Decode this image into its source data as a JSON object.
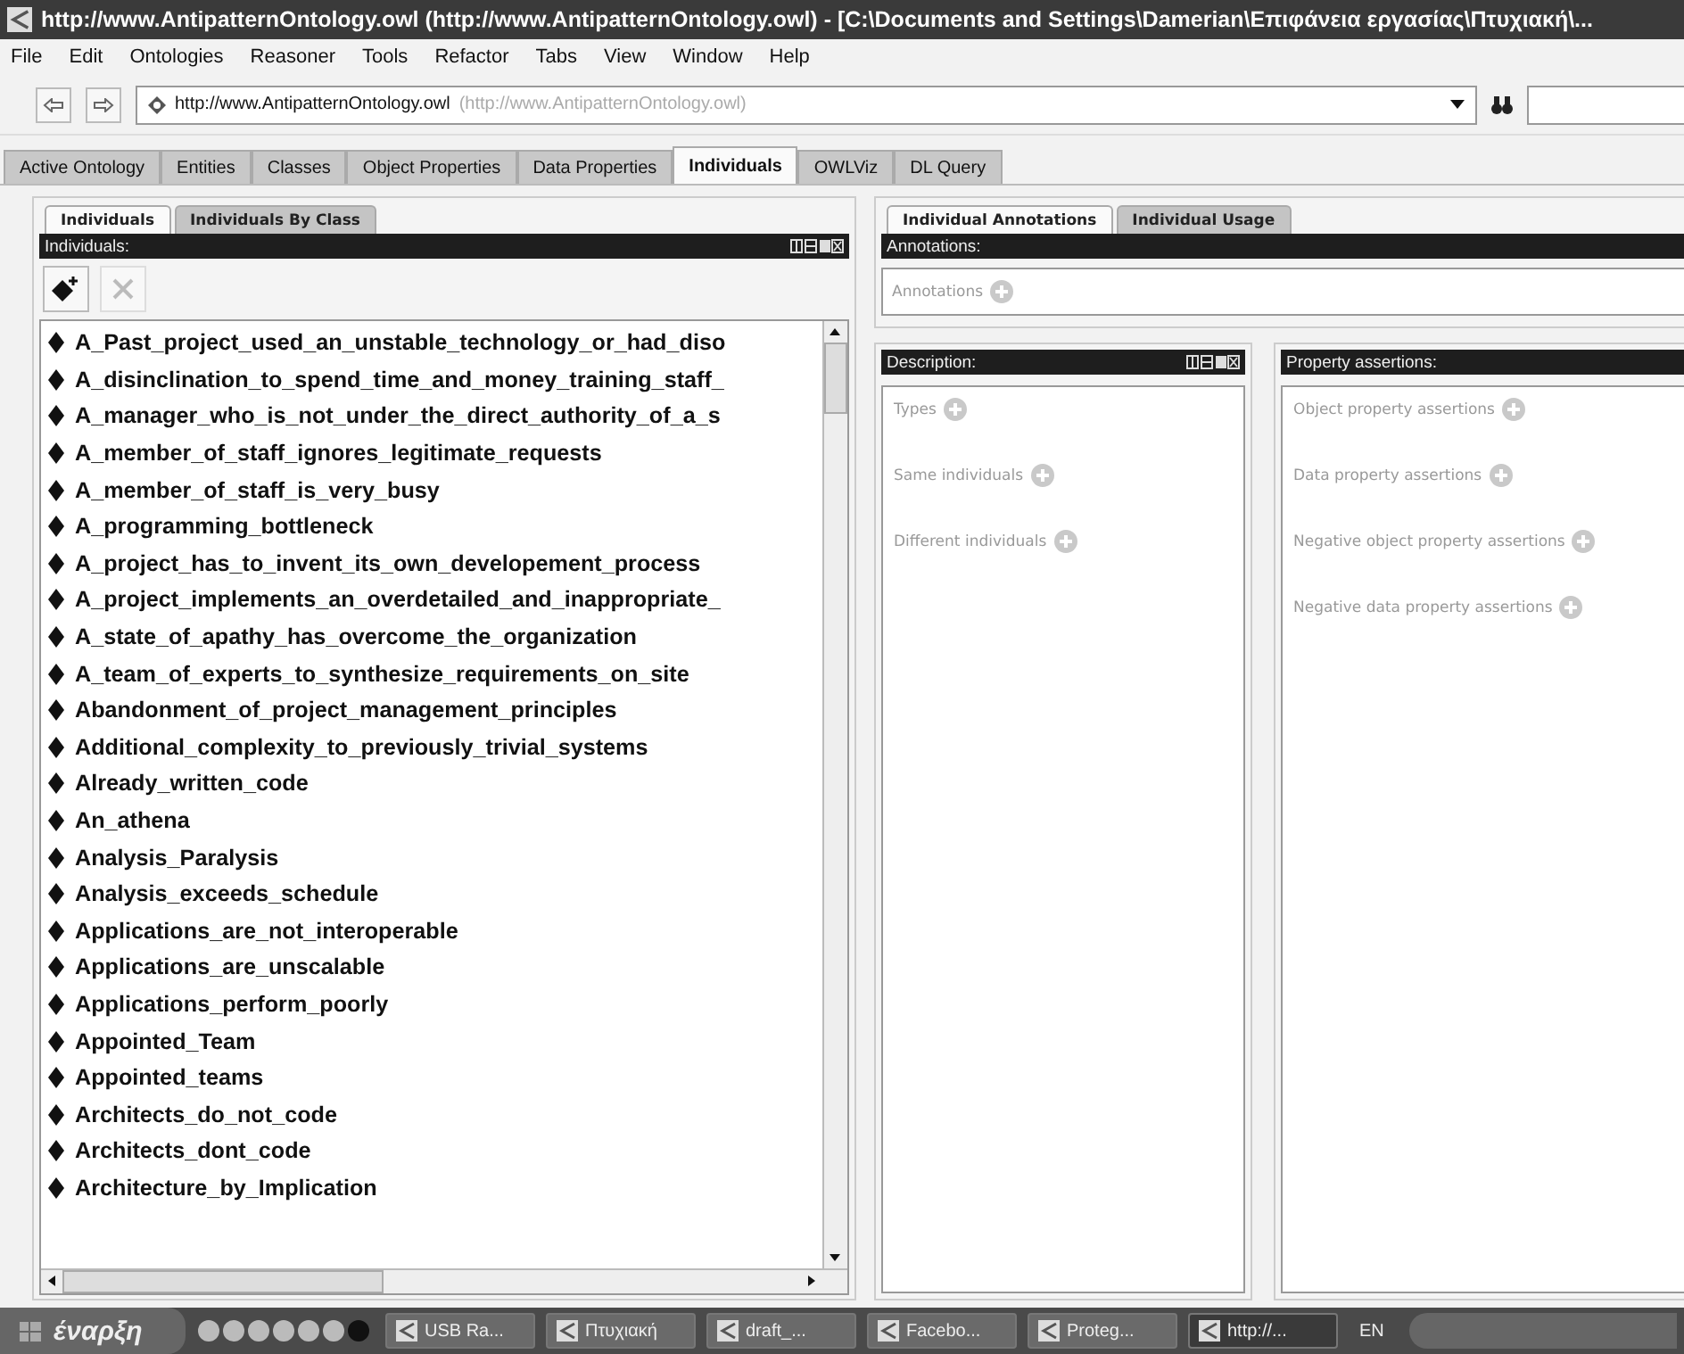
{
  "window": {
    "title": "http://www.AntipatternOntology.owl (http://www.AntipatternOntology.owl) - [C:\\Documents and Settings\\Damerian\\Επιφάνεια εργασίας\\Πτυχιακή\\..."
  },
  "menu": [
    "File",
    "Edit",
    "Ontologies",
    "Reasoner",
    "Tools",
    "Refactor",
    "Tabs",
    "View",
    "Window",
    "Help"
  ],
  "address": {
    "url": "http://www.AntipatternOntology.owl",
    "url_note": "(http://www.AntipatternOntology.owl)"
  },
  "tabs": [
    {
      "label": "Active Ontology",
      "selected": false
    },
    {
      "label": "Entities",
      "selected": false
    },
    {
      "label": "Classes",
      "selected": false
    },
    {
      "label": "Object Properties",
      "selected": false
    },
    {
      "label": "Data Properties",
      "selected": false
    },
    {
      "label": "Individuals",
      "selected": true
    },
    {
      "label": "OWLViz",
      "selected": false
    },
    {
      "label": "DL Query",
      "selected": false
    }
  ],
  "left": {
    "tabs": [
      {
        "label": "Individuals",
        "selected": true
      },
      {
        "label": "Individuals By Class",
        "selected": false
      }
    ],
    "header": "Individuals:",
    "tools": [
      {
        "kind": "add",
        "disabled": false
      },
      {
        "kind": "delete",
        "disabled": true
      }
    ],
    "items": [
      "A_Past_project_used_an_unstable_technology_or_had_diso",
      "A_disinclination_to_spend_time_and_money_training_staff_",
      "A_manager_who_is_not_under_the_direct_authority_of_a_s",
      "A_member_of_staff_ignores_legitimate_requests",
      "A_member_of_staff_is_very_busy",
      "A_programming_bottleneck",
      "A_project_has_to_invent_its_own_developement_process",
      "A_project_implements_an_overdetailed_and_inappropriate_",
      "A_state_of_apathy_has_overcome_the_organization",
      "A_team_of_experts_to_synthesize_requirements_on_site",
      "Abandonment_of_project_management_principles",
      "Additional_complexity_to_previously_trivial_systems",
      "Already_written_code",
      "An_athena",
      "Analysis_Paralysis",
      "Analysis_exceeds_schedule",
      "Applications_are_not_interoperable",
      "Applications_are_unscalable",
      "Applications_perform_poorly",
      "Appointed_Team",
      "Appointed_teams",
      "Architects_do_not_code",
      "Architects_dont_code",
      "Architecture_by_Implication"
    ]
  },
  "right": {
    "tabs": [
      {
        "label": "Individual Annotations",
        "selected": true
      },
      {
        "label": "Individual Usage",
        "selected": false
      }
    ],
    "annotations_header": "Annotations:",
    "annotations": [
      "Annotations"
    ],
    "description": {
      "header": "Description:",
      "sections": [
        "Types",
        "Same individuals",
        "Different individuals"
      ]
    },
    "property": {
      "header": "Property assertions:",
      "sections": [
        "Object property assertions",
        "Data property assertions",
        "Negative object property assertions",
        "Negative data property assertions"
      ]
    }
  },
  "taskbar": {
    "start": "έναρξη",
    "buttons": [
      {
        "label": "USB Ra...",
        "selected": false
      },
      {
        "label": "Πτυχιακή",
        "selected": false
      },
      {
        "label": "draft_...",
        "selected": false
      },
      {
        "label": "Facebo...",
        "selected": false
      },
      {
        "label": "Proteg...",
        "selected": false
      },
      {
        "label": "http://...",
        "selected": true
      }
    ],
    "language": "EN"
  }
}
